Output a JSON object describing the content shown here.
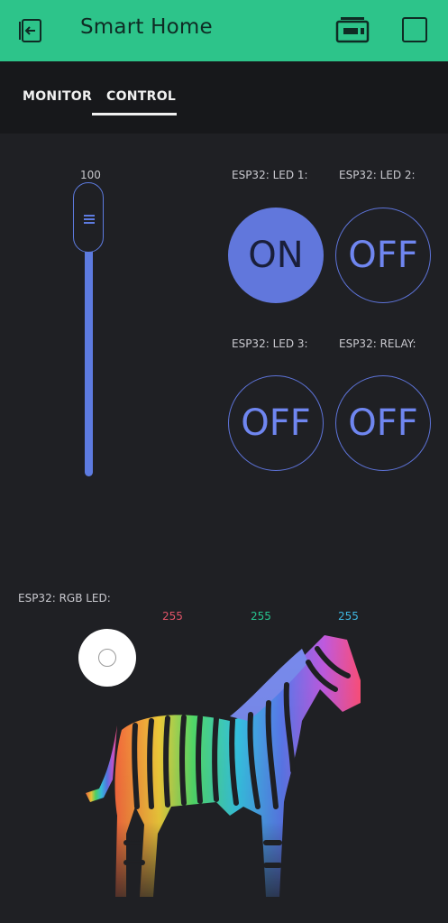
{
  "app": {
    "title": "Smart Home"
  },
  "tabs": [
    {
      "label": "MONITOR"
    },
    {
      "label": "CONTROL"
    }
  ],
  "slider": {
    "value": "100",
    "level_fraction": 1.0
  },
  "leds": [
    {
      "label": "ESP32: LED 1:",
      "state": "ON"
    },
    {
      "label": "ESP32: LED 2:",
      "state": "OFF"
    },
    {
      "label": "ESP32: LED 3:",
      "state": "OFF"
    },
    {
      "label": "ESP32: RELAY:",
      "state": "OFF"
    }
  ],
  "rgb": {
    "label": "ESP32: RGB LED:",
    "r": "255",
    "g": "255",
    "b": "255"
  },
  "colors": {
    "header": "#2dc48a",
    "accent": "#5d7be0",
    "red": "#e25468",
    "green": "#27c58f",
    "blue": "#3fb8e3"
  },
  "icons": {
    "back": "exit-icon",
    "battery": "battery-icon",
    "menu": "square-icon",
    "grip": "grip-icon",
    "picker": "color-picker-icon"
  }
}
